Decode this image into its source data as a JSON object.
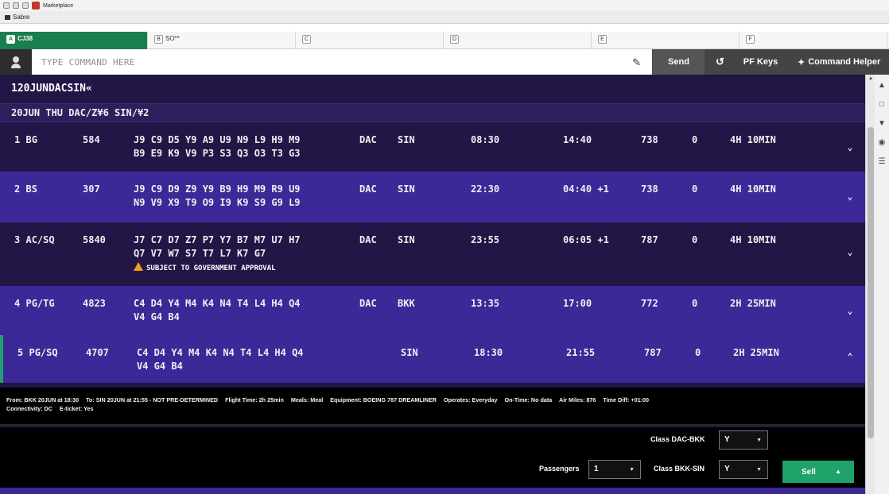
{
  "window": {
    "top_label": "Marketplace",
    "app_title": "Sabre"
  },
  "tabs": [
    {
      "letter": "A",
      "label": "CJ38"
    },
    {
      "letter": "B",
      "label": "SO**"
    },
    {
      "letter": "C",
      "label": ""
    },
    {
      "letter": "D",
      "label": ""
    },
    {
      "letter": "E",
      "label": ""
    },
    {
      "letter": "F",
      "label": ""
    }
  ],
  "command_bar": {
    "placeholder": "TYPE COMMAND HERE",
    "value": "",
    "send_label": "Send",
    "pf_keys_label": "PF Keys",
    "helper_label": "Command Helper"
  },
  "terminal": {
    "echo": "120JUNDACSIN«",
    "header": "20JUN THU DAC/Z¥6 SIN/¥2",
    "rows": [
      {
        "num": "1",
        "airline": "BG",
        "flight": "584",
        "classes_line1": "J9 C9 D5 Y9 A9 U9 N9 L9 H9 M9",
        "classes_line2": "B9 E9 K9 V9 P3 S3 Q3 O3 T3 G3",
        "origin": "DAC",
        "dest": "SIN",
        "depart": "08:30",
        "arrive": "14:40",
        "arrive_offset": "",
        "equipment": "738",
        "stops": "0",
        "duration": "4H 10MIN"
      },
      {
        "num": "2",
        "airline": "BS",
        "flight": "307",
        "classes_line1": "J9 C9 D9 Z9 Y9 B9 H9 M9 R9 U9",
        "classes_line2": "N9 V9 X9 T9 O9 I9 K9 S9 G9 L9",
        "origin": "DAC",
        "dest": "SIN",
        "depart": "22:30",
        "arrive": "04:40",
        "arrive_offset": "+1",
        "equipment": "738",
        "stops": "0",
        "duration": "4H 10MIN"
      },
      {
        "num": "3",
        "airline": "AC/SQ",
        "flight": "5840",
        "classes_line1": "J7 C7 D7 Z7 P7 Y7 B7 M7 U7 H7",
        "classes_line2": "Q7 V7 W7 S7 T7 L7 K7 G7",
        "warning": "SUBJECT TO GOVERNMENT APPROVAL",
        "origin": "DAC",
        "dest": "SIN",
        "depart": "23:55",
        "arrive": "06:05",
        "arrive_offset": "+1",
        "equipment": "787",
        "stops": "0",
        "duration": "4H 10MIN"
      },
      {
        "num": "4",
        "airline": "PG/TG",
        "flight": "4823",
        "classes_line1": "C4 D4 Y4 M4 K4 N4 T4 L4 H4 Q4",
        "classes_line2": "V4 G4 B4",
        "origin": "DAC",
        "dest": "BKK",
        "depart": "13:35",
        "arrive": "17:00",
        "arrive_offset": "",
        "equipment": "772",
        "stops": "0",
        "duration": "2H 25MIN"
      },
      {
        "num": "5",
        "airline": "PG/SQ",
        "flight": "4707",
        "classes_line1": "C4 D4 Y4 M4 K4 N4 T4 L4 H4 Q4",
        "classes_line2": "V4 G4 B4",
        "origin": "",
        "dest": "SIN",
        "depart": "18:30",
        "arrive": "21:55",
        "arrive_offset": "",
        "equipment": "787",
        "stops": "0",
        "duration": "2H 25MIN"
      }
    ]
  },
  "details": {
    "from": "From: BKK 20JUN at 18:30",
    "to": "To: SIN 20JUN at 21:55 - NOT PRE-DETERMINED",
    "flight_time": "Flight Time: 2h 25min",
    "meals": "Meals: Meal",
    "equipment": "Equipment: BOEING 787 DREAMLINER",
    "operates": "Operates: Everyday",
    "on_time": "On-Time: No data",
    "air_miles": "Air Miles: 876",
    "time_diff": "Time Diff: +01:00",
    "connectivity": "Connectivity: DC",
    "eticket": "E-ticket: Yes"
  },
  "sell": {
    "class1_label": "Class DAC-BKK",
    "class1_value": "Y",
    "class2_label": "Class BKK-SIN",
    "class2_value": "Y",
    "passengers_label": "Passengers",
    "passengers_value": "1",
    "sell_label": "Sell"
  },
  "colors": {
    "terminal_bg": "#231546",
    "row_highlight": "#3d2898",
    "active_tab": "#1a7f4f",
    "sell_button": "#1fa36b",
    "warning": "#f0a020"
  },
  "icons": {
    "chevron_down": "chevron-down-icon",
    "chevron_up": "chevron-up-icon",
    "edit": "edit-icon",
    "undo": "undo-icon",
    "wand": "wand-icon",
    "user": "user-icon",
    "warning": "warning-icon"
  }
}
